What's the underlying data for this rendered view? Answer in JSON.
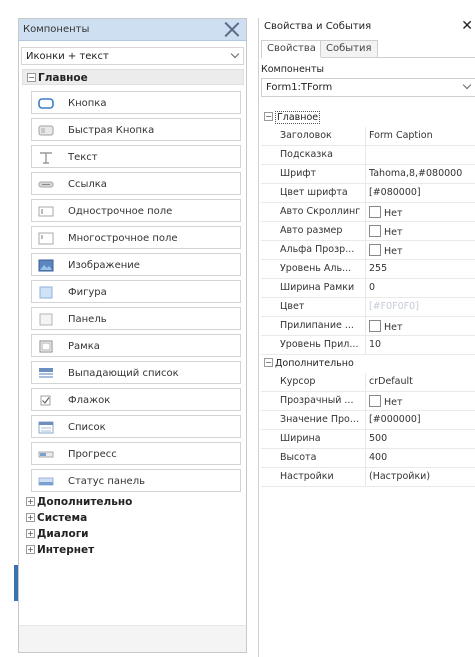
{
  "components_panel": {
    "title": "Компоненты",
    "view_mode": "Иконки + текст",
    "groups": {
      "main": "Главное",
      "additional": "Дополнительно",
      "system": "Система",
      "dialogs": "Диалоги",
      "internet": "Интернет"
    },
    "items": [
      {
        "label": "Кнопка",
        "icon": "button-icon"
      },
      {
        "label": "Быстрая Кнопка",
        "icon": "speed-button-icon"
      },
      {
        "label": "Текст",
        "icon": "text-icon"
      },
      {
        "label": "Ссылка",
        "icon": "link-icon"
      },
      {
        "label": "Однострочное поле",
        "icon": "single-line-field-icon"
      },
      {
        "label": "Многострочное поле",
        "icon": "multi-line-field-icon"
      },
      {
        "label": "Изображение",
        "icon": "image-icon"
      },
      {
        "label": "Фигура",
        "icon": "shape-icon"
      },
      {
        "label": "Панель",
        "icon": "panel-icon"
      },
      {
        "label": "Рамка",
        "icon": "frame-icon"
      },
      {
        "label": "Выпадающий список",
        "icon": "dropdown-icon"
      },
      {
        "label": "Флажок",
        "icon": "checkbox-icon"
      },
      {
        "label": "Список",
        "icon": "list-icon"
      },
      {
        "label": "Прогресс",
        "icon": "progress-icon"
      },
      {
        "label": "Статус панель",
        "icon": "status-bar-icon"
      }
    ]
  },
  "properties_panel": {
    "title": "Свойства и События",
    "close": "✕",
    "tabs": [
      "Свойства",
      "События"
    ],
    "components_label": "Компоненты",
    "selected_component": "Form1:TForm",
    "categories": {
      "main": "Главное",
      "additional": "Дополнительно"
    },
    "main_props": [
      {
        "name": "Заголовок",
        "value": "Form Caption"
      },
      {
        "name": "Подсказка",
        "value": ""
      },
      {
        "name": "Шрифт",
        "value": "Tahoma,8,#080000"
      },
      {
        "name": "Цвет шрифта",
        "value": "[#080000]"
      },
      {
        "name": "Авто Скроллинг",
        "value": "Нет",
        "checkbox": true
      },
      {
        "name": "Авто размер",
        "value": "Нет",
        "checkbox": true
      },
      {
        "name": "Альфа Прозр...",
        "value": "Нет",
        "checkbox": true
      },
      {
        "name": "Уровень Аль...",
        "value": "255"
      },
      {
        "name": "Ширина Рамки",
        "value": "0"
      },
      {
        "name": "Цвет",
        "value": "[#F0F0F0]",
        "faded": true
      },
      {
        "name": "Прилипание ...",
        "value": "Нет",
        "checkbox": true
      },
      {
        "name": "Уровень Прил...",
        "value": "10"
      }
    ],
    "additional_props": [
      {
        "name": "Курсор",
        "value": "crDefault"
      },
      {
        "name": "Прозрачный ...",
        "value": "Нет",
        "checkbox": true
      },
      {
        "name": "Значение Про...",
        "value": "[#000000]"
      },
      {
        "name": "Ширина",
        "value": "500"
      },
      {
        "name": "Высота",
        "value": "400"
      },
      {
        "name": "Настройки",
        "value": "(Настройки)"
      }
    ]
  }
}
